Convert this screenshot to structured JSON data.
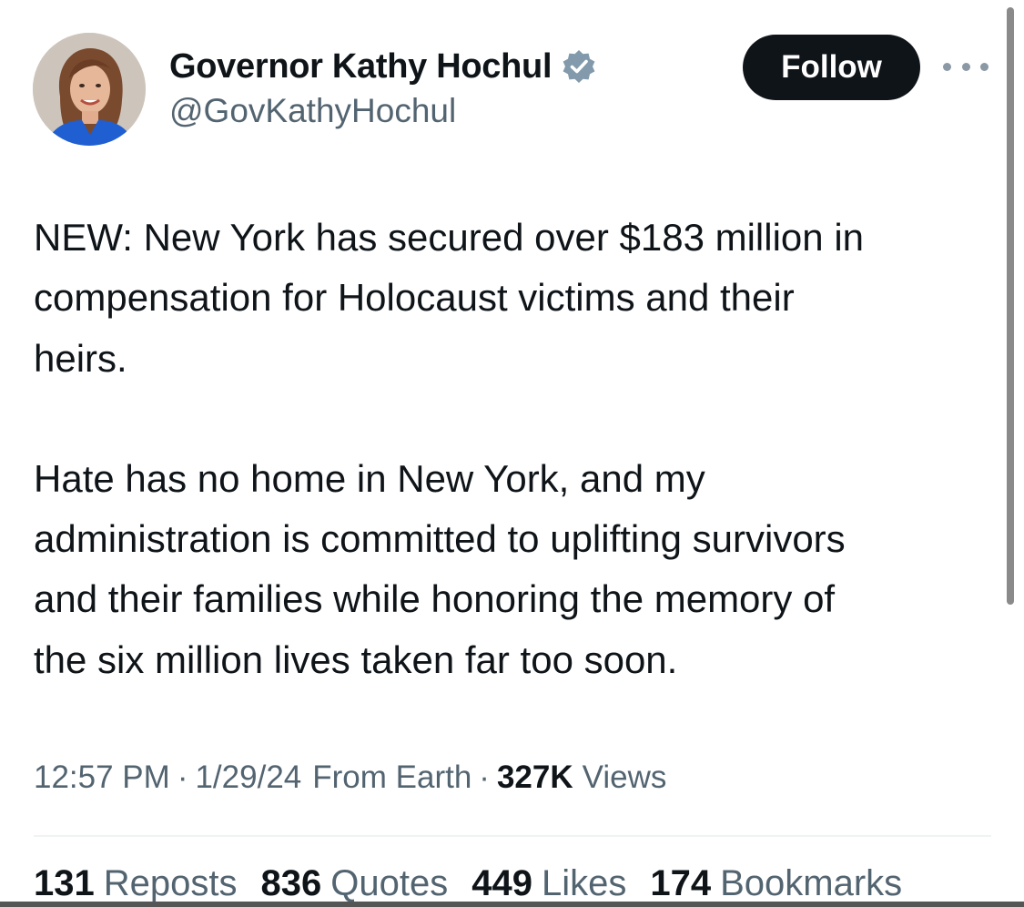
{
  "author": {
    "display_name": "Governor Kathy Hochul",
    "handle": "@GovKathyHochul",
    "avatar_icon": "profile-photo",
    "verified_icon": "verified-badge-icon"
  },
  "actions": {
    "follow_label": "Follow",
    "more_icon": "more-options-icon"
  },
  "tweet": {
    "paragraph1": [
      "NEW: New York has secured over $183 million in",
      "compensation for Holocaust victims and their",
      "heirs."
    ],
    "paragraph2": [
      "Hate has no home in New York, and my",
      "administration is committed to uplifting survivors",
      "and their families while honoring the memory of",
      "the six million lives taken far too soon."
    ]
  },
  "meta": {
    "time": "12:57 PM",
    "date": "1/29/24",
    "source": "From Earth",
    "views_count": "327K",
    "views_label": "Views",
    "separator": "·"
  },
  "stats": [
    {
      "count": "131",
      "label": "Reposts"
    },
    {
      "count": "836",
      "label": "Quotes"
    },
    {
      "count": "449",
      "label": "Likes"
    },
    {
      "count": "174",
      "label": "Bookmarks"
    }
  ],
  "colors": {
    "text_primary": "#0f1419",
    "text_secondary": "#536471",
    "verified_gray": "#829aab",
    "button_bg": "#0f1419"
  }
}
